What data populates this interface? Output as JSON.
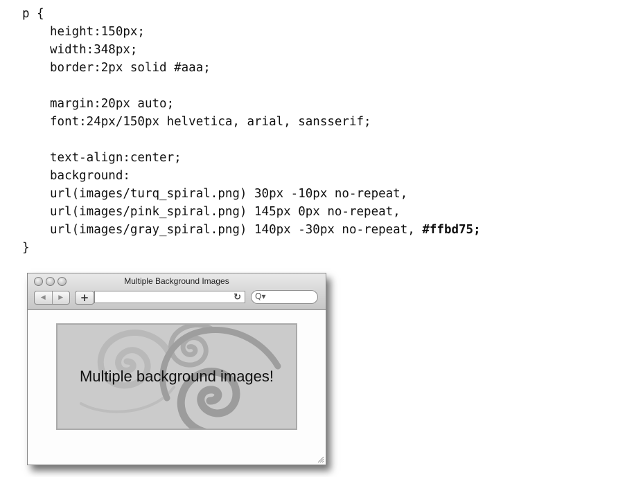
{
  "code": {
    "lines": [
      "p {",
      "height:150px;",
      "width:348px;",
      "border:2px solid #aaa;",
      "",
      "margin:20px auto;",
      "font:24px/150px helvetica, arial, sansserif;",
      "",
      "text-align:center;",
      "background:",
      "url(images/turq_spiral.png) 30px -10px no-repeat,",
      "url(images/pink_spiral.png) 145px 0px no-repeat,",
      "url(images/gray_spiral.png) 140px -30px no-repeat, ",
      "}"
    ],
    "bold_color_value": "#ffbd75;"
  },
  "window": {
    "title": "Multiple Background Images",
    "back_icon": "◀",
    "forward_icon": "▶",
    "add_icon": "+",
    "reload_icon": "↻",
    "search_icon": "Q▾"
  },
  "page": {
    "paragraph_text": "Multiple background images!",
    "paragraph_background": "#cbcbcb",
    "paragraph_border_color": "#aaaaaa",
    "spiral_colors": [
      "#b9b9b9",
      "#ababab",
      "#9c9c9c"
    ]
  }
}
